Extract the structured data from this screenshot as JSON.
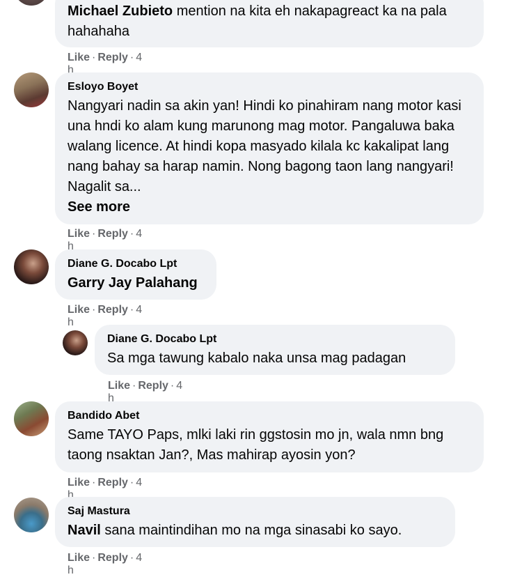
{
  "comments": [
    {
      "author": "Michael Zubieto",
      "text": "mention na kita eh nakapagreact ka na pala hahahaha",
      "like": "Like",
      "reply": "Reply",
      "time": "4 h"
    },
    {
      "author": "Esloyo Boyet",
      "text": "Nangyari nadin sa akin yan! Hindi ko pinahiram nang motor kasi una hndi ko alam kung marunong mag motor. Pangaluwa baka walang licence. At hindi kopa masyado kilala kc kakalipat lang nang bahay sa harap namin. Nong bagong taon lang nangyari! Nagalit sa...",
      "see_more": "See more",
      "like": "Like",
      "reply": "Reply",
      "time": "4 h"
    },
    {
      "author": "Diane G. Docabo Lpt",
      "mention": "Garry Jay Palahang",
      "like": "Like",
      "reply": "Reply",
      "time": "4 h"
    },
    {
      "author": "Diane G. Docabo Lpt",
      "text": "Sa mga tawung kabalo naka unsa mag padagan",
      "like": "Like",
      "reply": "Reply",
      "time": "4 h"
    },
    {
      "author": "Bandido Abet",
      "text": "Same TAYO Paps, mlki laki rin ggstosin mo jn, wala nmn bng taong nsaktan Jan?, Mas mahirap ayosin yon?",
      "like": "Like",
      "reply": "Reply",
      "time": "4 h"
    },
    {
      "author": "Saj Mastura",
      "mention": "Navil",
      "text": " sana maintindihan mo na mga sinasabi ko sayo.",
      "like": "Like",
      "reply": "Reply",
      "time": "4 h"
    }
  ],
  "separator": "·"
}
